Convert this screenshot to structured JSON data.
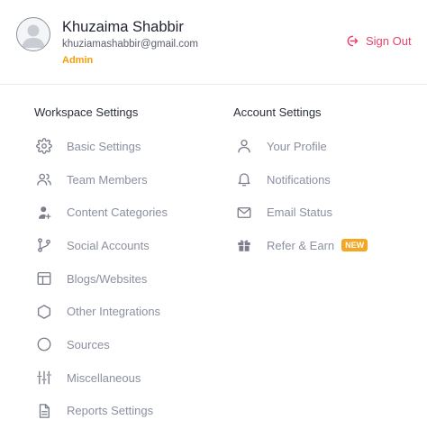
{
  "user": {
    "name": "Khuzaima Shabbir",
    "email": "khuziamashabbir@gmail.com",
    "role": "Admin",
    "sign_out_label": "Sign Out"
  },
  "workspace": {
    "title": "Workspace Settings",
    "items": [
      {
        "label": "Basic Settings",
        "icon": "gear-icon"
      },
      {
        "label": "Team Members",
        "icon": "users-icon"
      },
      {
        "label": "Content Categories",
        "icon": "categories-icon"
      },
      {
        "label": "Social Accounts",
        "icon": "branch-icon"
      },
      {
        "label": "Blogs/Websites",
        "icon": "layout-icon"
      },
      {
        "label": "Other Integrations",
        "icon": "hexagon-icon"
      },
      {
        "label": "Sources",
        "icon": "circle-icon"
      },
      {
        "label": "Miscellaneous",
        "icon": "sliders-icon"
      },
      {
        "label": "Reports Settings",
        "icon": "document-icon"
      }
    ]
  },
  "account": {
    "title": "Account Settings",
    "items": [
      {
        "label": "Your Profile",
        "icon": "user-icon"
      },
      {
        "label": "Notifications",
        "icon": "bell-icon"
      },
      {
        "label": "Email Status",
        "icon": "mail-icon"
      },
      {
        "label": "Refer & Earn",
        "icon": "gift-icon",
        "badge": "NEW"
      }
    ]
  },
  "colors": {
    "accent_signout": "#e5456a",
    "role": "#f59e0b",
    "badge": "#f5a623",
    "muted_text": "#8b90a0",
    "icon": "#7a7f8c"
  }
}
